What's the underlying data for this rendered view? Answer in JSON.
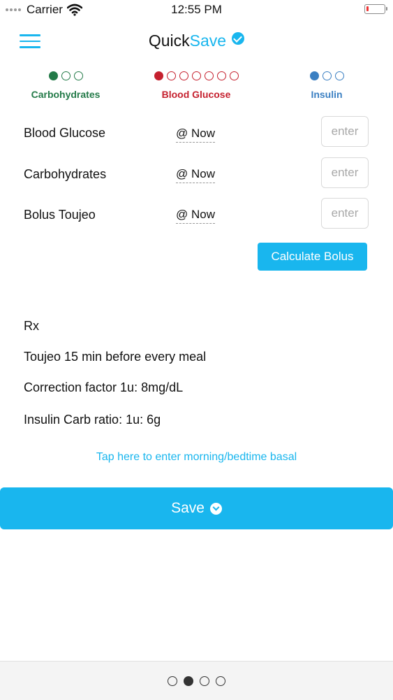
{
  "status_bar": {
    "carrier": "Carrier",
    "time": "12:55 PM"
  },
  "nav": {
    "title_part1": "Quick",
    "title_part2": "Save"
  },
  "progress": [
    {
      "label": "Carbohydrates",
      "filled": 1,
      "total": 3,
      "color": "#237a48"
    },
    {
      "label": "Blood Glucose",
      "filled": 1,
      "total": 7,
      "color": "#c5202e"
    },
    {
      "label": "Insulin",
      "filled": 1,
      "total": 3,
      "color": "#3a7fc2"
    }
  ],
  "entries": [
    {
      "label": "Blood Glucose",
      "time": "@ Now",
      "placeholder": "enter"
    },
    {
      "label": "Carbohydrates",
      "time": "@ Now",
      "placeholder": "enter"
    },
    {
      "label": "Bolus Toujeo",
      "time": "@ Now",
      "placeholder": "enter"
    }
  ],
  "calculate_label": "Calculate Bolus",
  "rx": {
    "heading": "Rx",
    "lines": [
      "Toujeo 15 min before every meal",
      "Correction factor 1u: 8mg/dL",
      "Insulin Carb ratio: 1u: 6g"
    ]
  },
  "basal_link": "Tap here to enter morning/bedtime basal",
  "save_label": "Save",
  "page_indicator": {
    "current": 2,
    "total": 4
  },
  "colors": {
    "accent": "#19b6ee"
  }
}
